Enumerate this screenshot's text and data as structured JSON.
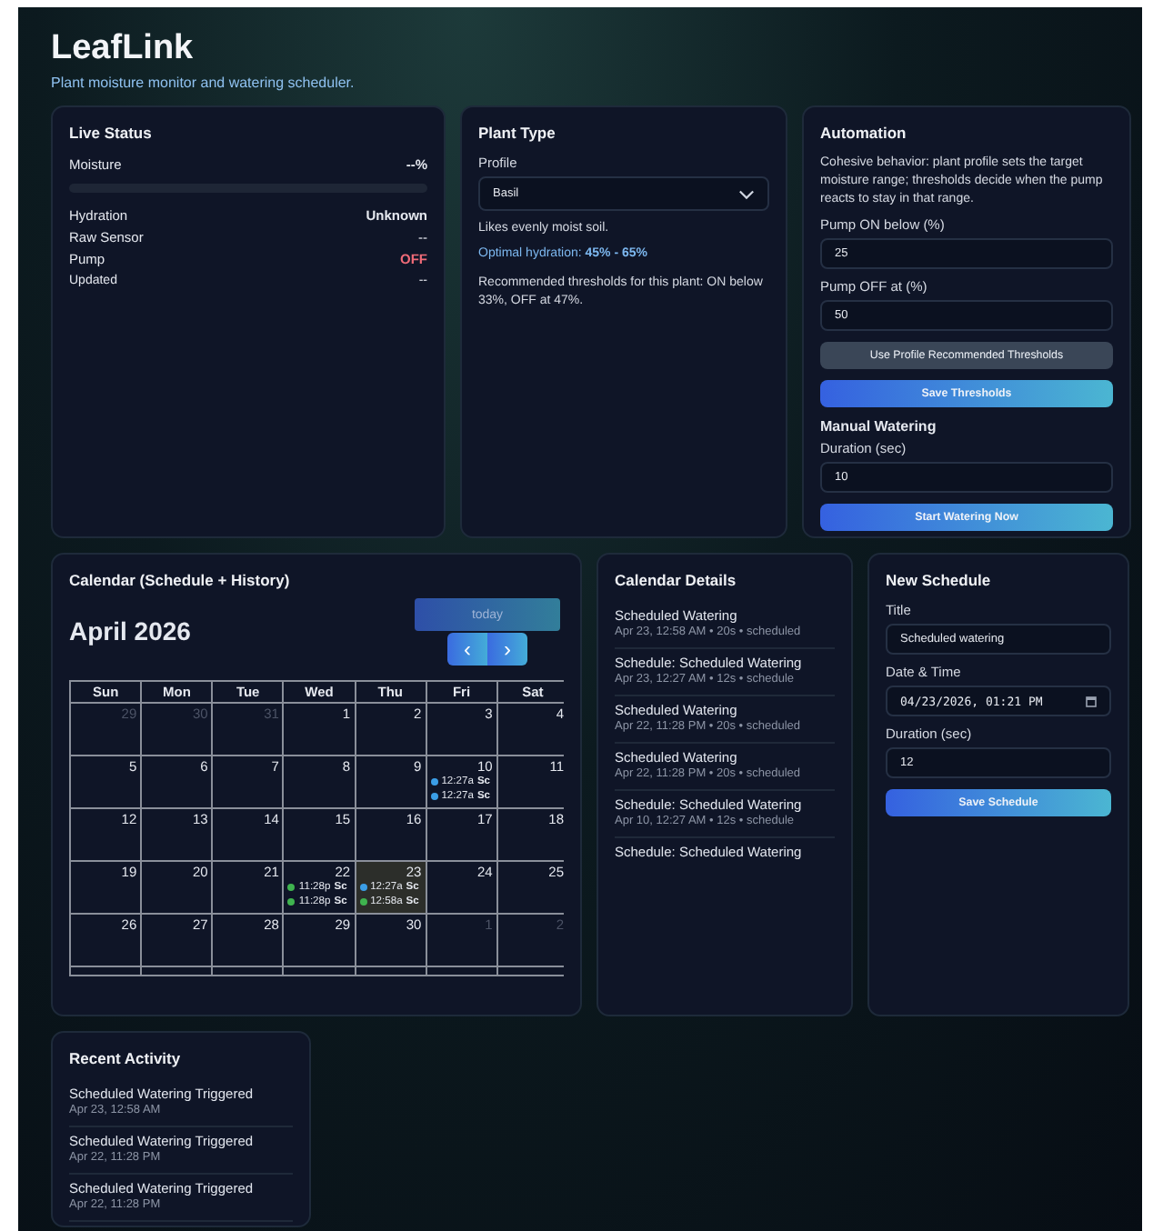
{
  "header": {
    "title": "LeafLink",
    "subtitle": "Plant moisture monitor and watering scheduler."
  },
  "live_status": {
    "title": "Live Status",
    "moisture_label": "Moisture",
    "moisture_value": "--%",
    "level": 0,
    "rows": [
      {
        "label": "Hydration",
        "value": "Unknown",
        "kind": "strong"
      },
      {
        "label": "Raw Sensor",
        "value": "--",
        "kind": "plain"
      },
      {
        "label": "Pump",
        "value": "OFF",
        "kind": "pump",
        "on": false
      },
      {
        "label": "Updated",
        "value": "--",
        "kind": "small"
      }
    ]
  },
  "plant_type": {
    "title": "Plant Type",
    "profile_label": "Profile",
    "profile_value": "Basil",
    "description": "Likes evenly moist soil.",
    "optimal_label": "Optimal hydration: ",
    "optimal_value": "45% - 65%",
    "recommendation": "Recommended thresholds for this plant: ON below 33%, OFF at 47%."
  },
  "automation": {
    "title": "Automation",
    "description": "Cohesive behavior: plant profile sets the target moisture range; thresholds decide when the pump reacts to stay in that range.",
    "pump_on_label": "Pump ON below (%)",
    "pump_on_value": "25",
    "pump_off_label": "Pump OFF at (%)",
    "pump_off_value": "50",
    "recommend_button": "Use Profile Recommended Thresholds",
    "save_button": "Save Thresholds",
    "manual_title": "Manual Watering",
    "duration_label": "Duration (sec)",
    "duration_value": "10",
    "start_button": "Start Watering Now"
  },
  "calendar": {
    "title": "Calendar (Schedule + History)",
    "month": "April 2026",
    "today_button": "today",
    "prev": "‹",
    "next": "›",
    "weekdays": [
      "Sun",
      "Mon",
      "Tue",
      "Wed",
      "Thu",
      "Fri",
      "Sat"
    ],
    "weeks": [
      [
        {
          "day": "29",
          "other_month": true,
          "today": false
        },
        {
          "day": "30",
          "other_month": true,
          "today": false
        },
        {
          "day": "31",
          "other_month": true,
          "today": false
        },
        {
          "day": "1",
          "other_month": false,
          "today": false
        },
        {
          "day": "2",
          "other_month": false,
          "today": false
        },
        {
          "day": "3",
          "other_month": false,
          "today": false
        },
        {
          "day": "4",
          "other_month": false,
          "today": false
        }
      ],
      [
        {
          "day": "5",
          "other_month": false,
          "today": false
        },
        {
          "day": "6",
          "other_month": false,
          "today": false
        },
        {
          "day": "7",
          "other_month": false,
          "today": false
        },
        {
          "day": "8",
          "other_month": false,
          "today": false
        },
        {
          "day": "9",
          "other_month": false,
          "today": false
        },
        {
          "day": "10",
          "other_month": false,
          "today": false,
          "events": [
            {
              "time": "12:27a",
              "title": "Sc",
              "color": "#3b9ee6"
            },
            {
              "time": "12:27a",
              "title": "Sc",
              "color": "#3b9ee6"
            }
          ]
        },
        {
          "day": "11",
          "other_month": false,
          "today": false
        }
      ],
      [
        {
          "day": "12",
          "other_month": false,
          "today": false
        },
        {
          "day": "13",
          "other_month": false,
          "today": false
        },
        {
          "day": "14",
          "other_month": false,
          "today": false
        },
        {
          "day": "15",
          "other_month": false,
          "today": false
        },
        {
          "day": "16",
          "other_month": false,
          "today": false
        },
        {
          "day": "17",
          "other_month": false,
          "today": false
        },
        {
          "day": "18",
          "other_month": false,
          "today": false
        }
      ],
      [
        {
          "day": "19",
          "other_month": false,
          "today": false
        },
        {
          "day": "20",
          "other_month": false,
          "today": false
        },
        {
          "day": "21",
          "other_month": false,
          "today": false
        },
        {
          "day": "22",
          "other_month": false,
          "today": false,
          "events": [
            {
              "time": "11:28p",
              "title": "Sc",
              "color": "#3fb34f"
            },
            {
              "time": "11:28p",
              "title": "Sc",
              "color": "#3fb34f"
            }
          ]
        },
        {
          "day": "23",
          "other_month": false,
          "today": true,
          "events": [
            {
              "time": "12:27a",
              "title": "Sc",
              "color": "#3b9ee6"
            },
            {
              "time": "12:58a",
              "title": "Sc",
              "color": "#3fb34f"
            }
          ]
        },
        {
          "day": "24",
          "other_month": false,
          "today": false
        },
        {
          "day": "25",
          "other_month": false,
          "today": false
        }
      ],
      [
        {
          "day": "26",
          "other_month": false,
          "today": false
        },
        {
          "day": "27",
          "other_month": false,
          "today": false
        },
        {
          "day": "28",
          "other_month": false,
          "today": false
        },
        {
          "day": "29",
          "other_month": false,
          "today": false
        },
        {
          "day": "30",
          "other_month": false,
          "today": false
        },
        {
          "day": "1",
          "other_month": true,
          "today": false
        },
        {
          "day": "2",
          "other_month": true,
          "today": false
        }
      ]
    ]
  },
  "calendar_details": {
    "title": "Calendar Details",
    "items": [
      {
        "title": "Scheduled Watering",
        "meta": "Apr 23, 12:58 AM • 20s • scheduled"
      },
      {
        "title": "Schedule: Scheduled Watering",
        "meta": "Apr 23, 12:27 AM • 12s • schedule"
      },
      {
        "title": "Scheduled Watering",
        "meta": "Apr 22, 11:28 PM • 20s • scheduled"
      },
      {
        "title": "Scheduled Watering",
        "meta": "Apr 22, 11:28 PM • 20s • scheduled"
      },
      {
        "title": "Schedule: Scheduled Watering",
        "meta": "Apr 10, 12:27 AM • 12s • schedule"
      },
      {
        "title": "Schedule: Scheduled Watering"
      }
    ]
  },
  "new_schedule": {
    "title": "New Schedule",
    "title_label": "Title",
    "title_value": "Scheduled watering",
    "datetime_label": "Date & Time",
    "datetime_value": "04/23/2026, 01:21 PM",
    "duration_label": "Duration (sec)",
    "duration_value": "12",
    "save_button": "Save Schedule"
  },
  "recent_activity": {
    "title": "Recent Activity",
    "items": [
      {
        "title": "Scheduled Watering Triggered",
        "time": "Apr 23, 12:58 AM"
      },
      {
        "title": "Scheduled Watering Triggered",
        "time": "Apr 22, 11:28 PM"
      },
      {
        "title": "Scheduled Watering Triggered",
        "time": "Apr 22, 11:28 PM"
      }
    ]
  }
}
